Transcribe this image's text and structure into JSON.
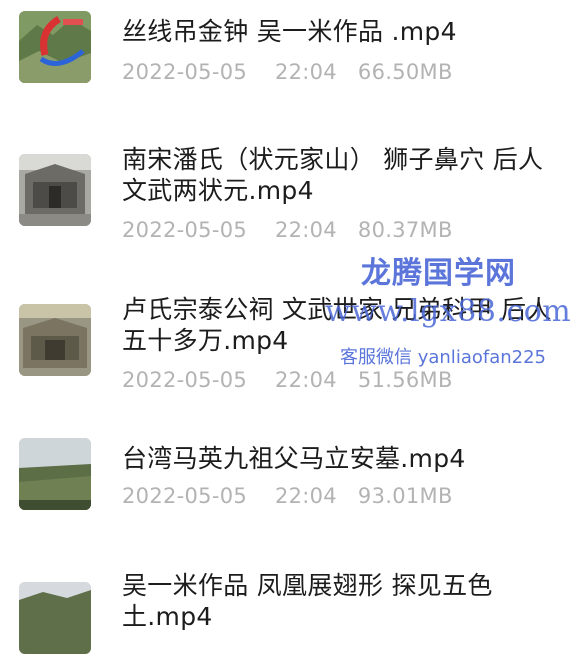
{
  "files": [
    {
      "name": "丝线吊金钟  吴一米作品  .mp4",
      "date": "2022-05-05",
      "time": "22:04",
      "size": "66.50MB",
      "thumb_icon": "mountain-video-thumbnail"
    },
    {
      "name": "南宋潘氏（状元家山）  狮子鼻穴  后人文武两状元.mp4",
      "date": "2022-05-05",
      "time": "22:04",
      "size": "80.37MB",
      "thumb_icon": "stone-tomb-video-thumbnail"
    },
    {
      "name": "卢氏宗泰公祠  文武世家  兄弟科甲  后人五十多万.mp4",
      "date": "2022-05-05",
      "time": "22:04",
      "size": "51.56MB",
      "thumb_icon": "ancestral-hall-video-thumbnail"
    },
    {
      "name": "台湾马英九祖父马立安墓.mp4",
      "date": "2022-05-05",
      "time": "22:04",
      "size": "93.01MB",
      "thumb_icon": "landscape-video-thumbnail"
    },
    {
      "name": "吴一米作品  凤凰展翅形  探见五色土.mp4",
      "date": "",
      "time": "",
      "size": "",
      "thumb_icon": "hills-video-thumbnail"
    }
  ],
  "watermark": {
    "title": "龙腾国学网",
    "url": "www.lgx88.com",
    "contact": "客服微信 yanliaofan225"
  }
}
